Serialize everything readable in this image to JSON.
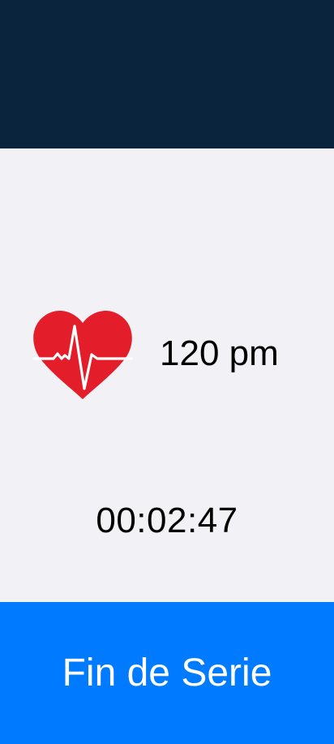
{
  "heart_rate": {
    "icon": "heart-pulse-icon",
    "value": "120 pm"
  },
  "timer": {
    "elapsed": "00:02:47"
  },
  "actions": {
    "end_series_label": "Fin de Serie"
  },
  "colors": {
    "header": "#0b243d",
    "background": "#f1f1f6",
    "heart": "#e31e2a",
    "button": "#007aff",
    "button_text": "#ffffff"
  }
}
